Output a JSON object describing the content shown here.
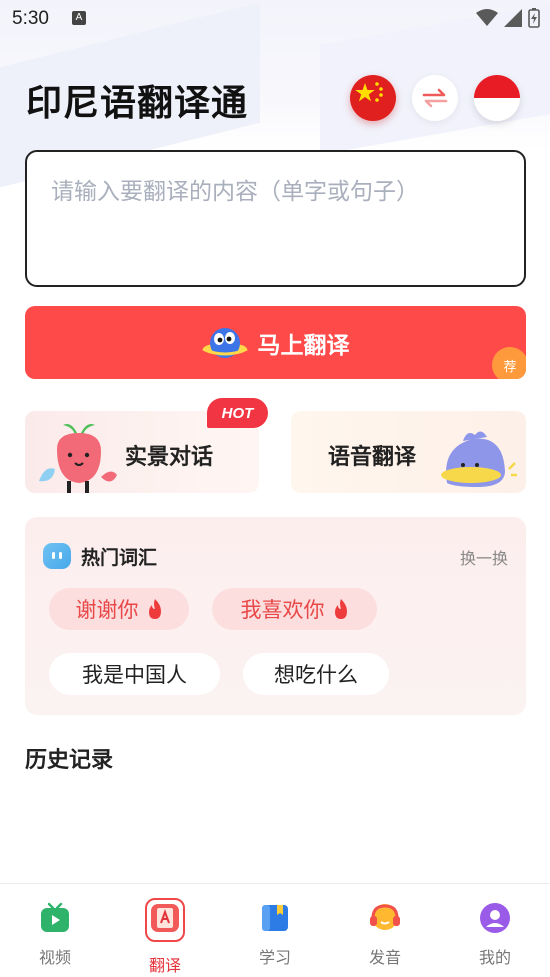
{
  "status_bar": {
    "time": "5:30",
    "notification_badge": "A"
  },
  "header": {
    "title": "印尼语翻译通",
    "source_flag": "china-flag-icon",
    "swap_icon": "swap-arrows-icon",
    "target_flag": "indonesia-flag-icon"
  },
  "input": {
    "placeholder": "请输入要翻译的内容（单字或句子）",
    "value": ""
  },
  "translate_button": {
    "label": "马上翻译",
    "badge": "荐"
  },
  "feature_cards": {
    "scene": {
      "label": "实景对话",
      "badge": "HOT"
    },
    "voice": {
      "label": "语音翻译"
    }
  },
  "hot_words": {
    "title": "热门词汇",
    "refresh": "换一换",
    "items": [
      {
        "text": "谢谢你",
        "hot": true
      },
      {
        "text": "我喜欢你",
        "hot": true
      },
      {
        "text": "我是中国人",
        "hot": false
      },
      {
        "text": "想吃什么",
        "hot": false
      }
    ]
  },
  "history": {
    "title": "历史记录"
  },
  "tabs": [
    {
      "label": "视频",
      "icon": "video-icon",
      "active": false
    },
    {
      "label": "翻译",
      "icon": "translate-icon",
      "active": true
    },
    {
      "label": "学习",
      "icon": "book-icon",
      "active": false
    },
    {
      "label": "发音",
      "icon": "headset-icon",
      "active": false
    },
    {
      "label": "我的",
      "icon": "profile-icon",
      "active": false
    }
  ],
  "colors": {
    "primary_red": "#ff4a4a",
    "accent_orange": "#ff9a3c",
    "tab_active": "#e3333a"
  }
}
